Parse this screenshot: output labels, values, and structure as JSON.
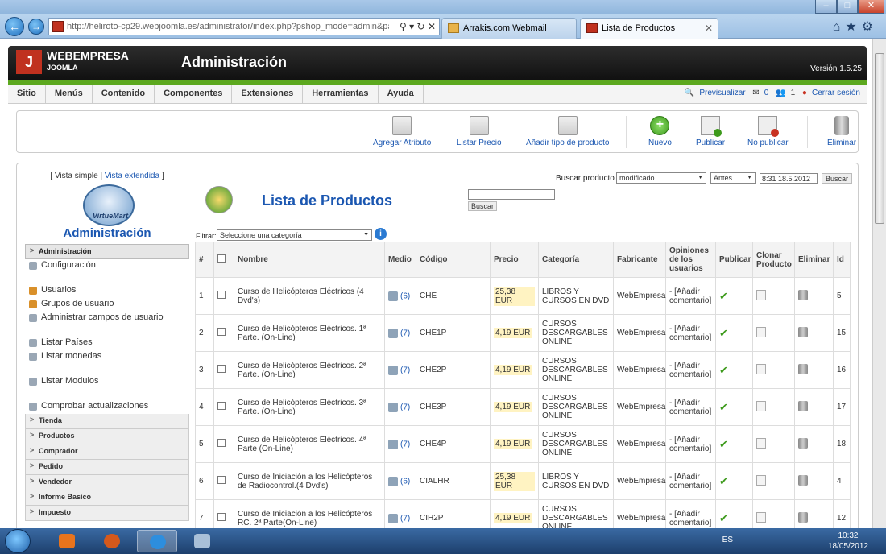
{
  "browser": {
    "url": "http://heliroto-cp29.webjoomla.es/administrator/index.php?pshop_mode=admin&page",
    "tabs": [
      {
        "label": "Arrakis.com Webmail"
      },
      {
        "label": "Lista de Productos"
      }
    ]
  },
  "header": {
    "brand": "WEBEMPRESA",
    "brand_sub": "JOOMLA",
    "title": "Administración",
    "version": "Versión 1.5.25"
  },
  "menu": {
    "items": [
      "Sitio",
      "Menús",
      "Contenido",
      "Componentes",
      "Extensiones",
      "Herramientas",
      "Ayuda"
    ],
    "preview": "Previsualizar",
    "messages": "0",
    "users": "1",
    "logout": "Cerrar sesión"
  },
  "toolbar": {
    "buttons": [
      {
        "label": "Agregar Atributo",
        "icon": "folder-icon"
      },
      {
        "label": "Listar Precio",
        "icon": "folder-icon"
      },
      {
        "label": "Añadir tipo de producto",
        "icon": "folder-icon"
      },
      {
        "label": "Nuevo",
        "icon": "plus-icon"
      },
      {
        "label": "Publicar",
        "icon": "publish-icon"
      },
      {
        "label": "No publicar",
        "icon": "unpublish-icon"
      },
      {
        "label": "Eliminar",
        "icon": "trash-icon"
      }
    ]
  },
  "sidebar": {
    "view_prefix": "[ Vista simple |",
    "view_extended": "Vista extendida",
    "view_suffix": "]",
    "logo_text": "VirtueMart",
    "title": "Administración",
    "section_admin": "Administración",
    "items": [
      "Configuración",
      "Usuarios",
      "Grupos de usuario",
      "Administrar campos de usuario",
      "Listar Países",
      "Listar monedas",
      "Listar Modulos",
      "Comprobar actualizaciones"
    ],
    "categories": [
      "Tienda",
      "Productos",
      "Comprador",
      "Pedido",
      "Vendedor",
      "Informe Basico",
      "Impuesto"
    ]
  },
  "main": {
    "title": "Lista de Productos",
    "search_button": "Buscar",
    "search_product_label": "Buscar producto",
    "search_mode": "modificado",
    "search_when": "Antes",
    "search_date": "8:31 18.5.2012",
    "search_button2": "Buscar",
    "filter_label": "Filtrar:",
    "filter_value": "Seleccione una categoría"
  },
  "table": {
    "headers": [
      "#",
      "",
      "Nombre",
      "Medio",
      "Código",
      "Precio",
      "Categoría",
      "Fabricante",
      "Opiniones de los usuarios",
      "Publicar",
      "Clonar Producto",
      "Eliminar",
      "Id"
    ],
    "rows": [
      {
        "n": "1",
        "name": "Curso de Helicópteros Eléctricos (4 Dvd's)",
        "media": "(6)",
        "code": "CHE",
        "price": "25,38 EUR",
        "category": "LIBROS Y CURSOS EN DVD",
        "maker": "WebEmpresa",
        "review": "- [Añadir comentario]",
        "id": "5"
      },
      {
        "n": "2",
        "name": "Curso de Helicópteros Eléctricos. 1ª Parte. (On-Line)",
        "media": "(7)",
        "code": "CHE1P",
        "price": "4,19 EUR",
        "category": "CURSOS DESCARGABLES ONLINE",
        "maker": "WebEmpresa",
        "review": "- [Añadir comentario]",
        "id": "15"
      },
      {
        "n": "3",
        "name": "Curso de Helicópteros Eléctricos. 2ª Parte. (On-Line)",
        "media": "(7)",
        "code": "CHE2P",
        "price": "4,19 EUR",
        "category": "CURSOS DESCARGABLES ONLINE",
        "maker": "WebEmpresa",
        "review": "- [Añadir comentario]",
        "id": "16"
      },
      {
        "n": "4",
        "name": "Curso de Helicópteros Eléctricos. 3ª Parte. (On-Line)",
        "media": "(7)",
        "code": "CHE3P",
        "price": "4,19 EUR",
        "category": "CURSOS DESCARGABLES ONLINE",
        "maker": "WebEmpresa",
        "review": "- [Añadir comentario]",
        "id": "17"
      },
      {
        "n": "5",
        "name": "Curso de Helicópteros Eléctricos. 4ª Parte (On-Line)",
        "media": "(7)",
        "code": "CHE4P",
        "price": "4,19 EUR",
        "category": "CURSOS DESCARGABLES ONLINE",
        "maker": "WebEmpresa",
        "review": "- [Añadir comentario]",
        "id": "18"
      },
      {
        "n": "6",
        "name": "Curso de Iniciación a los Helicópteros de Radiocontrol.(4 Dvd's)",
        "media": "(6)",
        "code": "CIALHR",
        "price": "25,38 EUR",
        "category": "LIBROS Y CURSOS EN DVD",
        "maker": "WebEmpresa",
        "review": "- [Añadir comentario]",
        "id": "4"
      },
      {
        "n": "7",
        "name": "Curso de Iniciación a los Helicópteros RC. 2ª Parte(On-Line)",
        "media": "(7)",
        "code": "CIH2P",
        "price": "4,19 EUR",
        "category": "CURSOS DESCARGABLES ONLINE",
        "maker": "WebEmpresa",
        "review": "- [Añadir comentario]",
        "id": "12"
      }
    ]
  },
  "taskbar": {
    "lang": "ES",
    "time": "10:32",
    "date": "18/05/2012"
  },
  "colors": {
    "joomla_green": "#5ca81f",
    "link_blue": "#1b57b1",
    "price_highlight": "#fff3c2"
  }
}
